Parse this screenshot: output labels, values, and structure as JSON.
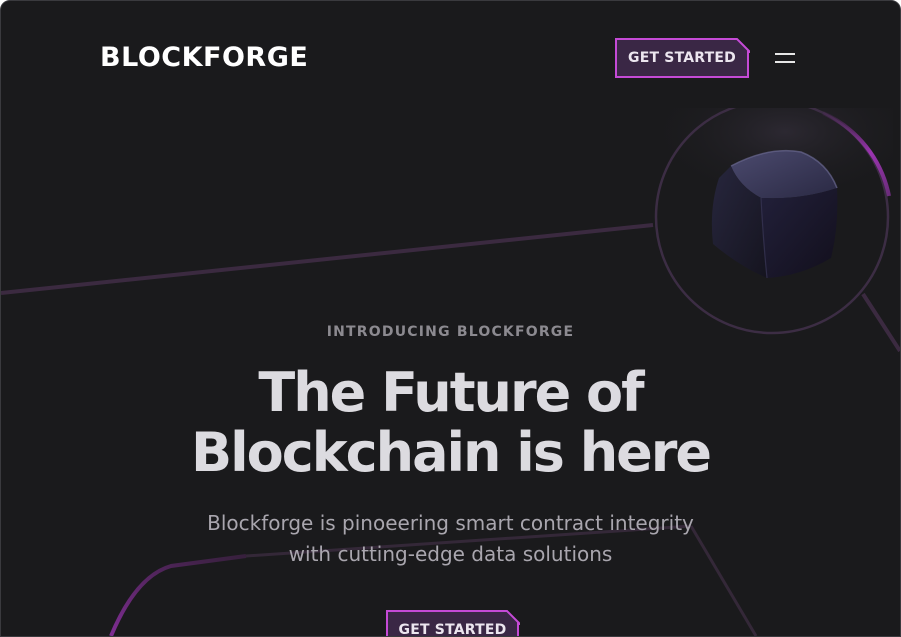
{
  "brand": {
    "name": "BLOCKFORGE"
  },
  "header": {
    "cta_label": "GET STARTED",
    "menu_icon": "hamburger-menu-icon"
  },
  "hero": {
    "eyebrow": "INTRODUCING BLOCKFORGE",
    "headline_line1": "The Future of",
    "headline_line2": "Blockchain is here",
    "subtitle_line1": "Blockforge is pinoeering smart contract integrity",
    "subtitle_line2": "with cutting-edge data solutions",
    "cta_label": "GET STARTED",
    "illustration": "cube-icon"
  },
  "colors": {
    "background": "#1a1a1c",
    "accent": "#c54ad6",
    "button_fill": "#3a2745",
    "headline": "#dcdbe0",
    "muted_text": "#8c8a90"
  }
}
